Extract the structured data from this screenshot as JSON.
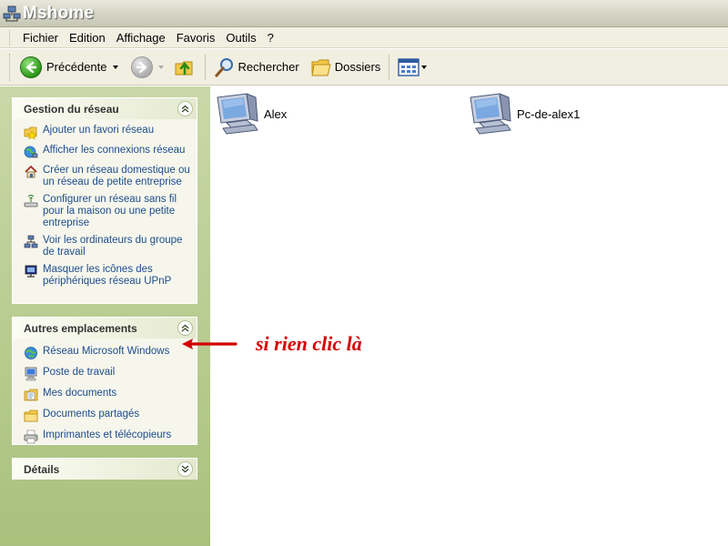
{
  "window": {
    "title": "Mshome"
  },
  "menu": [
    "Fichier",
    "Edition",
    "Affichage",
    "Favoris",
    "Outils",
    "?"
  ],
  "toolbar": {
    "back_label": "Précédente",
    "search_label": "Rechercher",
    "folders_label": "Dossiers"
  },
  "panels": {
    "network": {
      "title": "Gestion du réseau",
      "tasks": [
        {
          "label": "Ajouter un favori réseau",
          "icon": "add-network-place-icon"
        },
        {
          "label": "Afficher les connexions réseau",
          "icon": "network-connections-icon"
        },
        {
          "label": "Créer un réseau domestique ou un réseau de petite entreprise",
          "icon": "home-network-icon"
        },
        {
          "label": "Configurer un réseau sans fil pour la maison ou une petite entreprise",
          "icon": "wireless-network-icon"
        },
        {
          "label": "Voir les ordinateurs du groupe de travail",
          "icon": "workgroup-computers-icon"
        },
        {
          "label": "Masquer les icônes des périphériques réseau UPnP",
          "icon": "upnp-device-icon"
        }
      ]
    },
    "places": {
      "title": "Autres emplacements",
      "items": [
        {
          "label": "Réseau Microsoft Windows",
          "icon": "globe-network-icon"
        },
        {
          "label": "Poste de travail",
          "icon": "my-computer-icon"
        },
        {
          "label": "Mes documents",
          "icon": "my-documents-icon"
        },
        {
          "label": "Documents partagés",
          "icon": "shared-folder-icon"
        },
        {
          "label": "Imprimantes et télécopieurs",
          "icon": "printer-icon"
        }
      ]
    },
    "details": {
      "title": "Détails"
    }
  },
  "content": {
    "items": [
      {
        "label": "Alex",
        "icon": "networked-computer-icon"
      },
      {
        "label": "Pc-de-alex1",
        "icon": "networked-computer-icon"
      }
    ]
  },
  "annotation": {
    "text": "si rien clic là",
    "color": "#d40000"
  }
}
